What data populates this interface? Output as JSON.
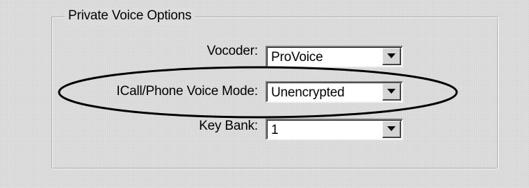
{
  "group": {
    "title": "Private Voice Options"
  },
  "fields": {
    "vocoder": {
      "label": "Vocoder:",
      "value": "ProVoice"
    },
    "voice_mode": {
      "label": "ICall/Phone Voice Mode:",
      "value": "Unencrypted"
    },
    "key_bank": {
      "label": "Key Bank:",
      "value": "1"
    }
  },
  "icons": {
    "dropdown": "chevron-down-icon",
    "highlight": "annotation-ellipse"
  }
}
